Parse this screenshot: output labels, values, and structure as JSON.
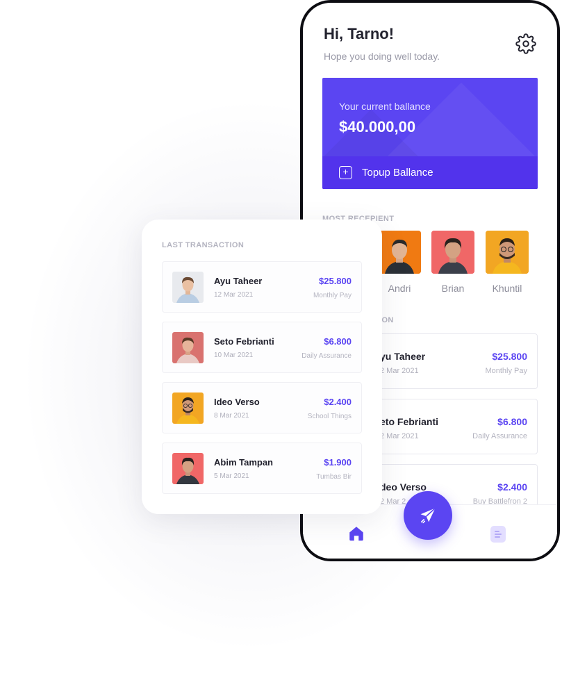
{
  "greeting": {
    "title": "Hi, Tarno!",
    "subtitle": "Hope you doing well today."
  },
  "balance": {
    "label": "Your current ballance",
    "amount": "$40.000,00",
    "topup_label": "Topup Ballance",
    "card_color": "#5B45F2"
  },
  "recipients": {
    "section_label": "MOST RECEPIENT",
    "items": [
      {
        "name": "",
        "avatar_bg": "#F0F0F4"
      },
      {
        "name": "Andri",
        "avatar_bg": "#F07A12"
      },
      {
        "name": "Brian",
        "avatar_bg": "#F06767"
      },
      {
        "name": "Khuntil",
        "avatar_bg": "#F2A623"
      }
    ]
  },
  "phone_transactions": {
    "section_label_partial": "ION",
    "items": [
      {
        "name": "yu Taheer",
        "date": "2 Mar 2021",
        "amount": "$25.800",
        "category": "Monthly Pay"
      },
      {
        "name": "eto Febrianti",
        "date": "2 Mar 2021",
        "amount": "$6.800",
        "category": "Daily Assurance"
      },
      {
        "name": "deo Verso",
        "date": "2 Mar 2",
        "amount": "$2.400",
        "category": "Buy Battlefron 2"
      }
    ]
  },
  "last_transaction": {
    "section_label": "LAST TRANSACTION",
    "items": [
      {
        "name": "Ayu Taheer",
        "date": "12 Mar 2021",
        "amount": "$25.800",
        "category": "Monthly Pay",
        "avatar_bg": "#E8EAEE"
      },
      {
        "name": "Seto Febrianti",
        "date": "10 Mar 2021",
        "amount": "$6.800",
        "category": "Daily Assurance",
        "avatar_bg": "#D9726F"
      },
      {
        "name": "Ideo Verso",
        "date": "8 Mar 2021",
        "amount": "$2.400",
        "category": "School Things",
        "avatar_bg": "#F2A623"
      },
      {
        "name": "Abim Tampan",
        "date": "5 Mar 2021",
        "amount": "$1.900",
        "category": "Tumbas Bir",
        "avatar_bg": "#F06767"
      }
    ]
  },
  "nav": {
    "home_icon": "home-icon",
    "send_icon": "send-icon",
    "list_icon": "list-icon",
    "accent": "#5B45F2"
  }
}
